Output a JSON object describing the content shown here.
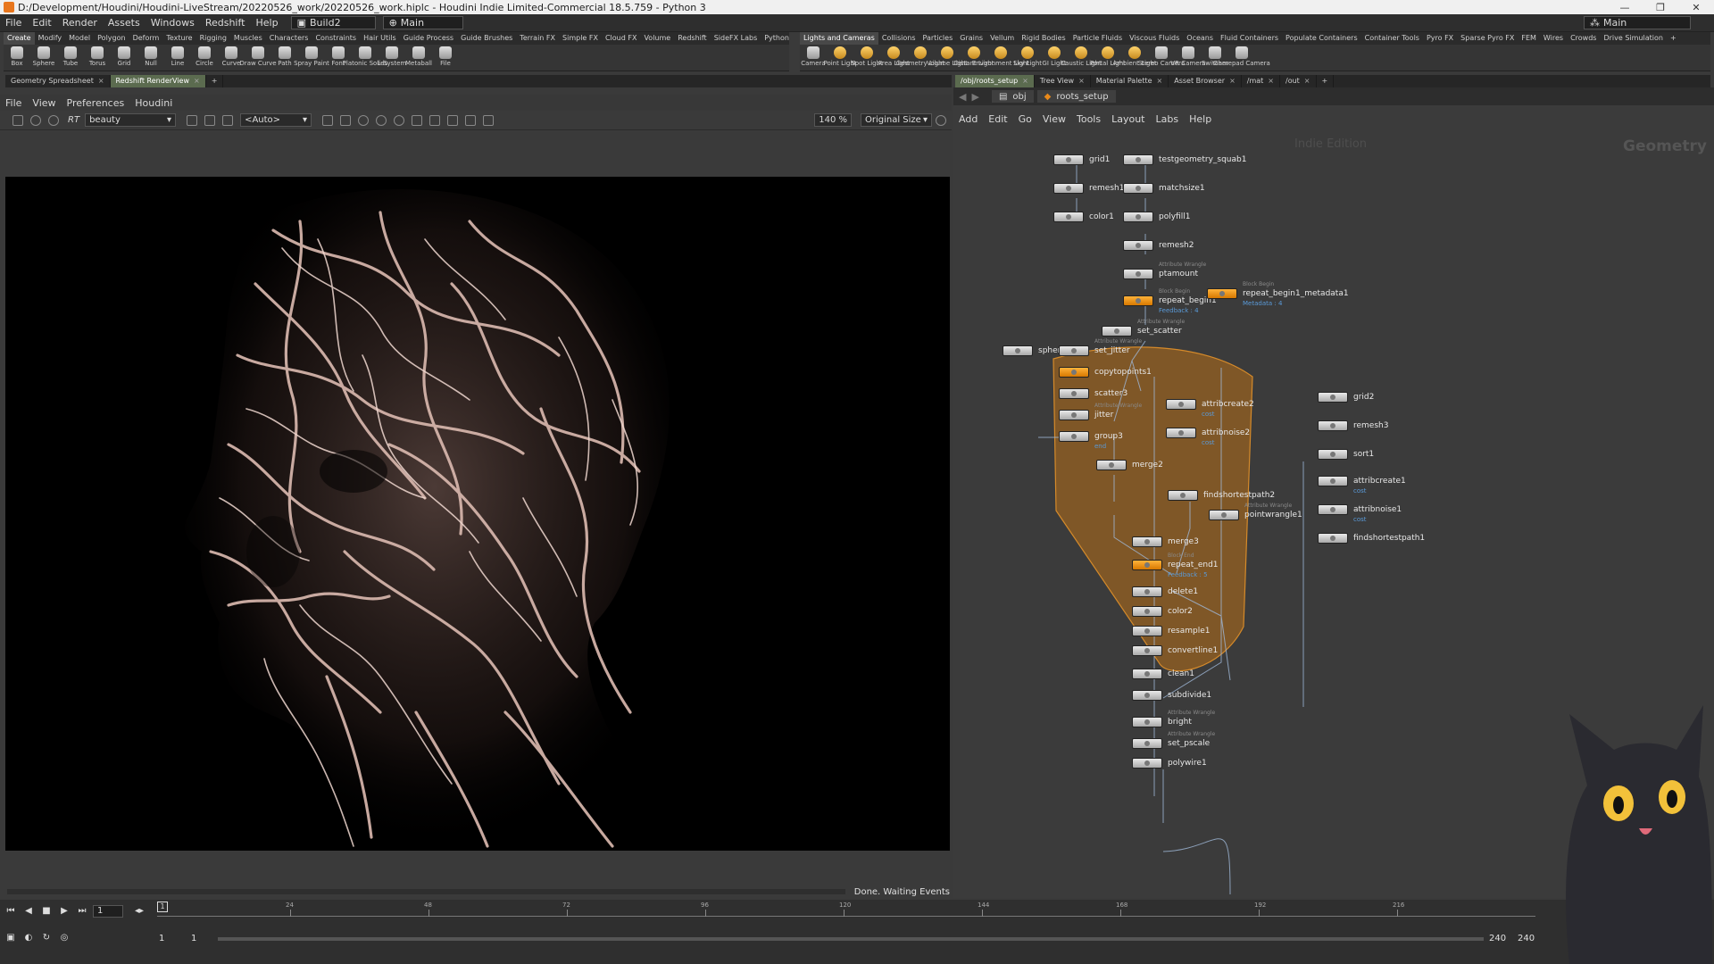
{
  "titlebar": {
    "title": "D:/Development/Houdini/Houdini-LiveStream/20220526_work/20220526_work.hiplc - Houdini Indie Limited-Commercial 18.5.759 - Python 3",
    "minimize": "—",
    "restore": "❐",
    "close": "✕"
  },
  "menubar": {
    "items": [
      "File",
      "Edit",
      "Render",
      "Assets",
      "Windows",
      "Redshift",
      "Help"
    ],
    "build_combo": "Build2",
    "main_combo": "Main",
    "desktop_combo": "Main"
  },
  "shelf_left": {
    "tabs": [
      "Create",
      "Modify",
      "Model",
      "Polygon",
      "Deform",
      "Texture",
      "Rigging",
      "Muscles",
      "Characters",
      "Constraints",
      "Hair Utils",
      "Guide Process",
      "Guide Brushes",
      "Terrain FX",
      "Simple FX",
      "Cloud FX",
      "Volume",
      "Redshift",
      "SideFX Labs",
      "Python"
    ],
    "active_tab": "Create",
    "tools": [
      "Box",
      "Sphere",
      "Tube",
      "Torus",
      "Grid",
      "Null",
      "Line",
      "Circle",
      "Curve",
      "Draw Curve",
      "Path",
      "Spray Paint",
      "Font",
      "Platonic Solids",
      "L-System",
      "Metaball",
      "File"
    ]
  },
  "shelf_right": {
    "tabs": [
      "Lights and Cameras",
      "Collisions",
      "Particles",
      "Grains",
      "Vellum",
      "Rigid Bodies",
      "Particle Fluids",
      "Viscous Fluids",
      "Oceans",
      "Fluid Containers",
      "Populate Containers",
      "Container Tools",
      "Pyro FX",
      "Sparse Pyro FX",
      "FEM",
      "Wires",
      "Crowds",
      "Drive Simulation"
    ],
    "active_tab": "Lights and Cameras",
    "tools": [
      "Camera",
      "Point Light",
      "Spot Light",
      "Area Light",
      "Geometry Light",
      "Volume Light",
      "Distant Light",
      "Environment Light",
      "Sky Light",
      "GI Light",
      "Caustic Light",
      "Portal Light",
      "Ambient Light",
      "Stereo Camera",
      "VR Camera",
      "Switcher",
      "Gamepad Camera"
    ]
  },
  "left_pane": {
    "tabs": [
      "Geometry Spreadsheet",
      "Redshift RenderView"
    ],
    "active_tab": "Redshift RenderView",
    "menu": [
      "File",
      "View",
      "Preferences",
      "Houdini"
    ],
    "toolbar": {
      "rt": "RT",
      "aov": "beauty",
      "camera": "<Auto>",
      "zoom": "140 %",
      "size": "Original Size"
    },
    "status": "Done. Waiting Events"
  },
  "right_pane": {
    "tabs": [
      "/obj/roots_setup",
      "Tree View",
      "Material Palette",
      "Asset Browser",
      "/mat",
      "/out"
    ],
    "active_tab": "/obj/roots_setup",
    "path": [
      "obj",
      "roots_setup"
    ],
    "menu": [
      "Add",
      "Edit",
      "Go",
      "View",
      "Tools",
      "Layout",
      "Labs",
      "Help"
    ],
    "watermark_edition": "Indie Edition",
    "watermark_context": "Geometry",
    "nodes": [
      {
        "name": "grid1",
        "style": "gray"
      },
      {
        "name": "testgeometry_squab1",
        "style": "gray"
      },
      {
        "name": "remesh1",
        "style": "gray"
      },
      {
        "name": "matchsize1",
        "style": "gray"
      },
      {
        "name": "color1",
        "style": "gray"
      },
      {
        "name": "polyfill1",
        "style": "gray"
      },
      {
        "name": "remesh2",
        "style": "gray"
      },
      {
        "name": "ptamount",
        "style": "gray",
        "hint": "Attribute Wrangle"
      },
      {
        "name": "repeat_begin1",
        "style": "orange",
        "hint": "Block Begin",
        "sub": "Feedback : 4"
      },
      {
        "name": "repeat_begin1_metadata1",
        "style": "orange",
        "hint": "Block Begin",
        "sub": "Metadata : 4"
      },
      {
        "name": "set_scatter",
        "style": "gray",
        "hint": "Attribute Wrangle"
      },
      {
        "name": "sphere",
        "style": "gray"
      },
      {
        "name": "set_jitter",
        "style": "gray",
        "hint": "Attribute Wrangle"
      },
      {
        "name": "copytopoints1",
        "style": "orange"
      },
      {
        "name": "scatter3",
        "style": "gray"
      },
      {
        "name": "jitter",
        "style": "gray",
        "hint": "Attribute Wrangle"
      },
      {
        "name": "group3",
        "style": "gray",
        "sub": "end"
      },
      {
        "name": "attribcreate2",
        "style": "gray",
        "sub": "cost"
      },
      {
        "name": "attribnoise2",
        "style": "gray",
        "sub": "cost"
      },
      {
        "name": "merge2",
        "style": "gray"
      },
      {
        "name": "findshortestpath2",
        "style": "gray"
      },
      {
        "name": "pointwrangle1",
        "style": "gray",
        "hint": "Attribute Wrangle"
      },
      {
        "name": "merge3",
        "style": "gray"
      },
      {
        "name": "repeat_end1",
        "style": "orange",
        "hint": "Block End",
        "sub": "Feedback : 5"
      },
      {
        "name": "delete1",
        "style": "gray"
      },
      {
        "name": "color2",
        "style": "gray"
      },
      {
        "name": "resample1",
        "style": "gray"
      },
      {
        "name": "convertline1",
        "style": "gray"
      },
      {
        "name": "clean1",
        "style": "gray"
      },
      {
        "name": "subdivide1",
        "style": "gray"
      },
      {
        "name": "bright",
        "style": "gray",
        "hint": "Attribute Wrangle"
      },
      {
        "name": "set_pscale",
        "style": "gray",
        "hint": "Attribute Wrangle"
      },
      {
        "name": "polywire1",
        "style": "gray"
      },
      {
        "name": "grid2",
        "style": "gray"
      },
      {
        "name": "remesh3",
        "style": "gray"
      },
      {
        "name": "sort1",
        "style": "gray"
      },
      {
        "name": "attribcreate1",
        "style": "gray",
        "sub": "cost"
      },
      {
        "name": "attribnoise1",
        "style": "gray",
        "sub": "cost"
      },
      {
        "name": "findshortestpath1",
        "style": "gray"
      }
    ]
  },
  "timeline": {
    "current_frame": "1",
    "ruler_labels": [
      "24",
      "48",
      "72",
      "96",
      "120",
      "144",
      "168",
      "192",
      "216"
    ],
    "start_a": "1",
    "start_b": "1",
    "end_a": "240",
    "end_b": "240"
  },
  "colors": {
    "accent_orange": "#e8891a",
    "loop_box": "#c47a1a",
    "link_blue": "#5a9ad8"
  }
}
